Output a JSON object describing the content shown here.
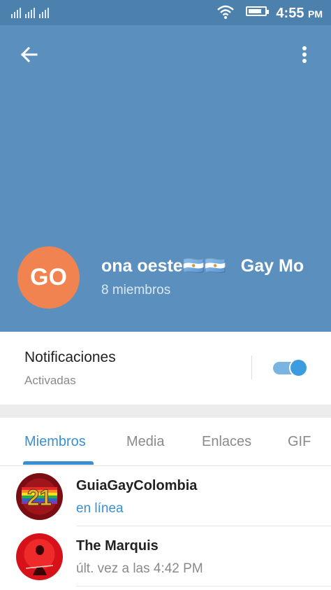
{
  "status_bar": {
    "time": "4:55",
    "ampm": "PM",
    "battery_level": 0.8,
    "icons": [
      "signal-icon",
      "wifi-icon",
      "battery-icon"
    ]
  },
  "header": {
    "avatar_initials": "GO",
    "avatar_color": "#f0834f",
    "title": "ona oeste🇦🇷🇦🇷   Gay Mo",
    "subtitle": "8 miembros",
    "background_color": "#5b8fbe",
    "icons": [
      "back-arrow-icon",
      "more-vertical-icon"
    ]
  },
  "notifications": {
    "title": "Notificaciones",
    "status": "Activadas",
    "enabled": true
  },
  "tabs": [
    {
      "label": "Miembros",
      "active": true
    },
    {
      "label": "Media",
      "active": false
    },
    {
      "label": "Enlaces",
      "active": false
    },
    {
      "label": "GIF",
      "active": false
    }
  ],
  "members": [
    {
      "name": "GuiaGayColombia",
      "status": "en línea",
      "online": true,
      "avatar_icon": "anniversary-21-avatar"
    },
    {
      "name": "The Marquis",
      "status": "últ. vez a las 4:42 PM",
      "online": false,
      "avatar_icon": "red-stage-avatar"
    }
  ],
  "accent_color": "#3a8fd3"
}
